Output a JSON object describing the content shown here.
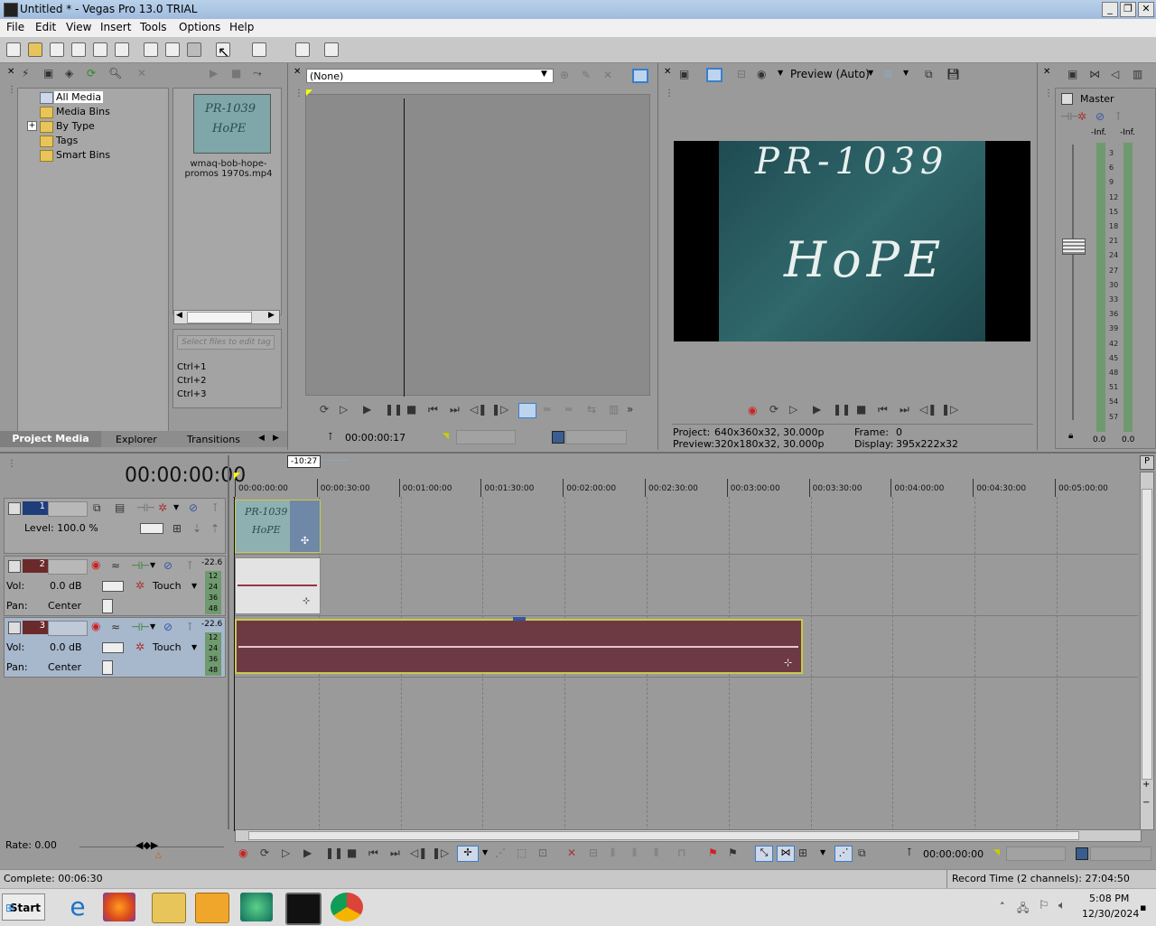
{
  "window": {
    "title": "Untitled * - Vegas Pro 13.0 TRIAL",
    "buttons": {
      "minimize": "_",
      "maximize": "❐",
      "close": "✕"
    }
  },
  "menu": [
    "File",
    "Edit",
    "View",
    "Insert",
    "Tools",
    "Options",
    "Help"
  ],
  "project_media": {
    "tree": [
      "All Media",
      "Media Bins",
      "By Type",
      "Tags",
      "Smart Bins"
    ],
    "expand_glyph": "+",
    "media_file": "wmaq-bob-hope-promos 1970s.mp4",
    "thumb_text": [
      "PR-1039",
      "HoPE"
    ],
    "tag_placeholder": "Select files to edit tag",
    "shortcuts": [
      "Ctrl+1",
      "Ctrl+2",
      "Ctrl+3"
    ],
    "tabs": [
      "Project Media",
      "Explorer",
      "Transitions"
    ]
  },
  "trimmer": {
    "dropdown_value": "(None)",
    "timecode": "00:00:00:17"
  },
  "preview": {
    "mode": "Preview (Auto)",
    "image_text": [
      "PR-1039",
      "HoPE"
    ],
    "project_label": "Project:",
    "project_value": "640x360x32, 30.000p",
    "preview_label": "Preview:",
    "preview_value": "320x180x32, 30.000p",
    "frame_label": "Frame:",
    "frame_value": "0",
    "display_label": "Display:",
    "display_value": "395x222x32"
  },
  "master": {
    "label": "Master",
    "inf_left": "-Inf.",
    "inf_right": "-Inf.",
    "scale": [
      "3",
      "6",
      "9",
      "12",
      "15",
      "18",
      "21",
      "24",
      "27",
      "30",
      "33",
      "36",
      "39",
      "42",
      "45",
      "48",
      "51",
      "54",
      "57"
    ],
    "bottom_left": "0.0",
    "bottom_right": "0.0"
  },
  "timeline": {
    "timecode": "00:00:00:00",
    "marker": "-10:27",
    "ruler": [
      "00:00:00:00",
      "00:00:30:00",
      "00:01:00:00",
      "00:01:30:00",
      "00:02:00:00",
      "00:02:30:00",
      "00:03:00:00",
      "00:03:30:00",
      "00:04:00:00",
      "00:04:30:00",
      "00:05:00:00"
    ],
    "tracks": [
      {
        "num": "1",
        "level": "Level: 100.0 %"
      },
      {
        "num": "2",
        "vol_label": "Vol:",
        "vol": "0.0 dB",
        "pan_label": "Pan:",
        "pan": "Center",
        "mode": "Touch",
        "peak": "-22.6",
        "scale": [
          "12",
          "24",
          "36",
          "48"
        ]
      },
      {
        "num": "3",
        "vol_label": "Vol:",
        "vol": "0.0 dB",
        "pan_label": "Pan:",
        "pan": "Center",
        "mode": "Touch",
        "peak": "-22.6",
        "scale": [
          "12",
          "24",
          "36",
          "48"
        ]
      }
    ],
    "clip_text": [
      "PR-1039",
      "HoPE"
    ],
    "rate": "Rate: 0.00",
    "transport_timecode": "00:00:00:00"
  },
  "status": {
    "complete": "Complete: 00:06:30",
    "record_time": "Record Time (2 channels): 27:04:50"
  },
  "taskbar": {
    "start": "Start",
    "time": "5:08 PM",
    "date": "12/30/2024"
  },
  "colors": {
    "clip_video": "#6f88a8",
    "clip_audio_red": "#6d3a44",
    "selected_track": "#a7b7cc",
    "title_gradient_top": "#b9d1ea"
  }
}
